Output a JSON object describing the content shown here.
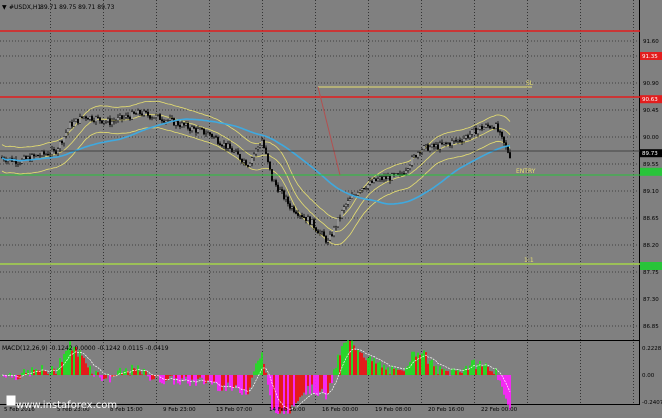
{
  "chart_header": {
    "menu_glyph": "▼",
    "symbol_tf": "#USDX,H1",
    "ohlc": "89.71 89.75 89.71 89.73"
  },
  "price_axis": {
    "ticks": [
      "91.60",
      "91.35",
      "90.90",
      "90.45",
      "90.00",
      "89.55",
      "89.10",
      "88.65",
      "88.20",
      "87.75",
      "87.30",
      "86.85"
    ],
    "badges": [
      {
        "label": "91.35",
        "color": "#e21e1e",
        "text_color": "#ffffff"
      },
      {
        "label": "90.63",
        "color": "#e21e1e",
        "text_color": "#ffffff"
      },
      {
        "label": "89.73",
        "color": "#000000",
        "text_color": "#ffffff"
      },
      {
        "label": "89.42",
        "color": "#29c43a",
        "text_color": "#29c43a"
      },
      {
        "label": "87.85",
        "color": "#29c43a",
        "text_color": "#29c43a"
      }
    ]
  },
  "levels": {
    "sl_label": "SL",
    "entry_label": "ENTRY",
    "tp_label": "1:1"
  },
  "macd_panel": {
    "title": "MACD(12,26,9) -0.1242 0.0000 -0.1242 0.0115 -0.0419",
    "ticks": [
      "0.2228",
      "0.00",
      "-0.2407"
    ]
  },
  "time_axis": {
    "labels": [
      "5 Feb 2016",
      "5 Feb 23:00",
      "8 Feb 15:00",
      "9 Feb 23:00",
      "13 Feb 07:00",
      "14 Feb 16:00",
      "16 Feb 00:00",
      "19 Feb 08:00",
      "20 Feb 16:00",
      "22 Feb 00:00"
    ]
  },
  "watermark": {
    "text": "www.instaforex.com"
  },
  "colors": {
    "background": "#808080",
    "grid": "#000000",
    "candle": "#000000",
    "ma_blue": "#3fa9df",
    "bands_yellow": "#e8e070",
    "resistance_red": "#e21e1e",
    "support_green": "#29c43a",
    "macd_green": "#22dd22",
    "macd_magenta": "#ff22ff",
    "macd_red": "#ee1111"
  }
}
